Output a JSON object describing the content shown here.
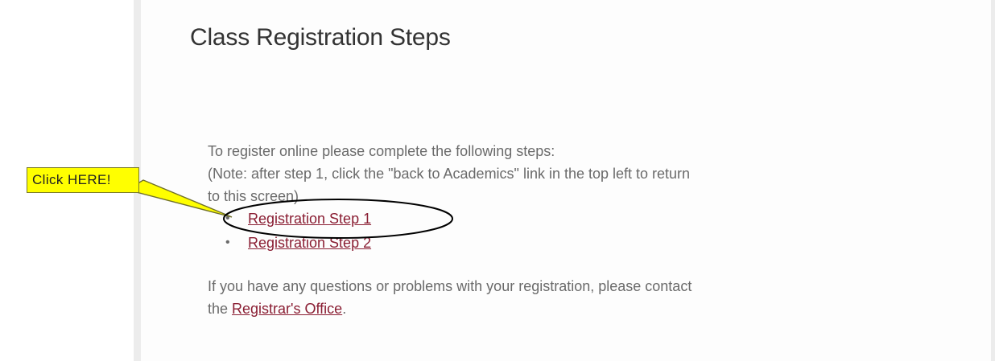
{
  "page": {
    "title": "Class Registration Steps",
    "intro": "To register online please complete the following steps:",
    "note_line1": "(Note: after step 1, click the \"back to Academics\" link in the top left to return",
    "note_line2": "to this screen)",
    "steps": [
      {
        "bullet": "•",
        "label": "Registration Step 1"
      },
      {
        "bullet": "•",
        "label": "Registration Step 2"
      }
    ],
    "footer_line1": "If you have any questions or problems with your registration, please contact",
    "footer_prefix": "the ",
    "footer_link": "Registrar's Office",
    "footer_suffix": "."
  },
  "annotation": {
    "callout_text": "Click HERE!",
    "callout_color": "#ffff00",
    "circle_color": "#000000"
  },
  "colors": {
    "link": "#8a1e33",
    "body_text": "#6a6a6a",
    "title_text": "#333333"
  }
}
